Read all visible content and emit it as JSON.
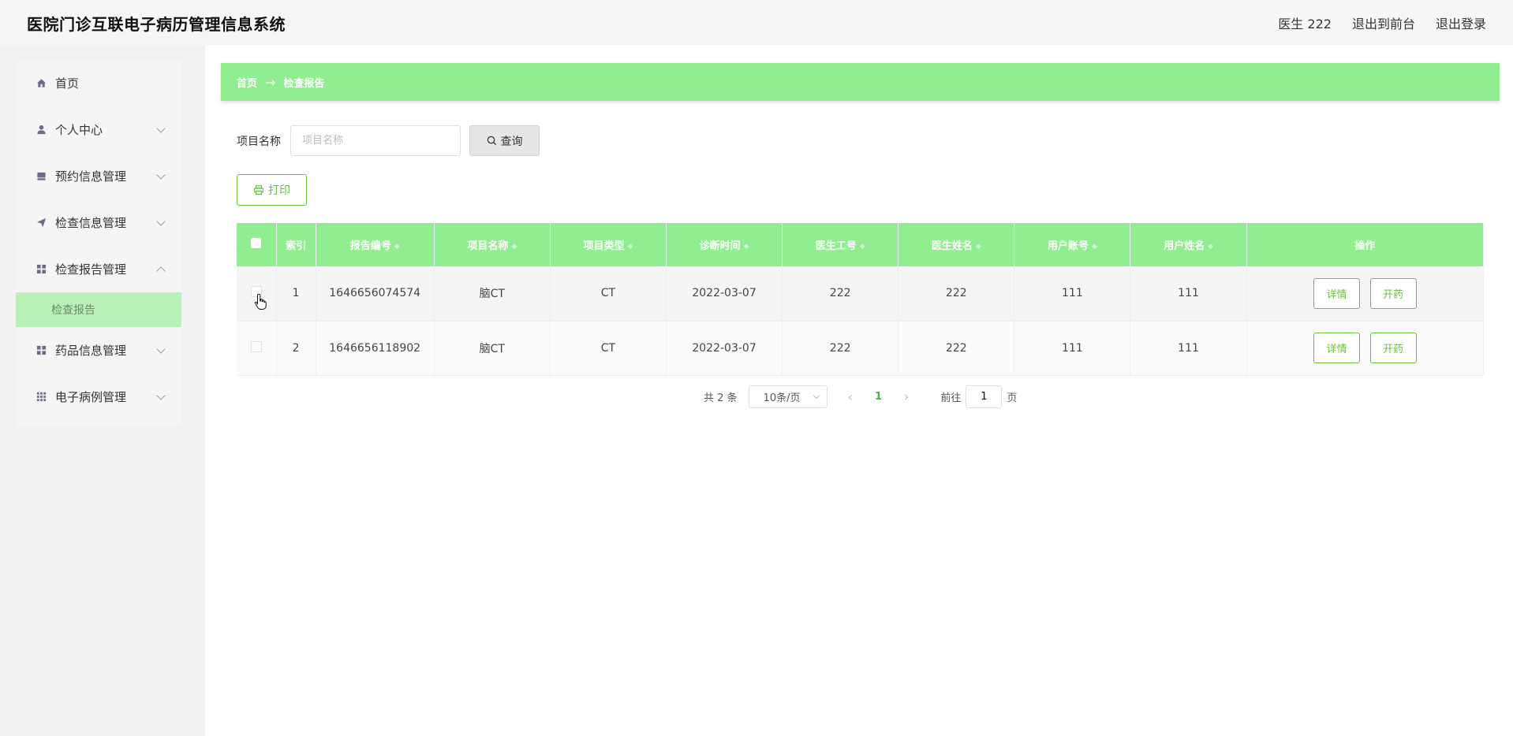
{
  "header": {
    "title": "医院门诊互联电子病历管理信息系统",
    "user": "医生 222",
    "back_to_front": "退出到前台",
    "logout": "退出登录"
  },
  "sidebar": {
    "items": [
      {
        "label": "首页",
        "icon": "home-icon"
      },
      {
        "label": "个人中心",
        "icon": "user-icon"
      },
      {
        "label": "预约信息管理",
        "icon": "calendar-icon"
      },
      {
        "label": "检查信息管理",
        "icon": "send-icon"
      },
      {
        "label": "检查报告管理",
        "icon": "grid-icon"
      },
      {
        "label": "药品信息管理",
        "icon": "grid-icon"
      },
      {
        "label": "电子病例管理",
        "icon": "apps-icon"
      }
    ],
    "active_sub": "检查报告"
  },
  "breadcrumb": {
    "home": "首页",
    "arrow": "→",
    "current": "检查报告"
  },
  "search": {
    "label": "项目名称",
    "placeholder": "项目名称",
    "button": "查询"
  },
  "print_button": "打印",
  "table": {
    "headers": [
      "索引",
      "报告编号",
      "项目名称",
      "项目类型",
      "诊断时间",
      "医生工号",
      "医生姓名",
      "用户账号",
      "用户姓名",
      "操作"
    ],
    "rows": [
      {
        "index": "1",
        "report_no": "1646656074574",
        "item_name": "脑CT",
        "item_type": "CT",
        "diag_time": "2022-03-07",
        "doctor_id": "222",
        "doctor_name": "222",
        "user_account": "111",
        "user_name": "111"
      },
      {
        "index": "2",
        "report_no": "1646656118902",
        "item_name": "脑CT",
        "item_type": "CT",
        "diag_time": "2022-03-07",
        "doctor_id": "222",
        "doctor_name": "222",
        "user_account": "111",
        "user_name": "111"
      }
    ],
    "detail_label": "详情",
    "prescribe_label": "开药"
  },
  "pagination": {
    "total": "共 2 条",
    "page_size": "10条/页",
    "current_page": "1",
    "goto_prefix": "前往",
    "goto_value": "1",
    "goto_suffix": "页"
  },
  "colors": {
    "accent_green": "#90ee90",
    "button_green": "#67c23a"
  }
}
